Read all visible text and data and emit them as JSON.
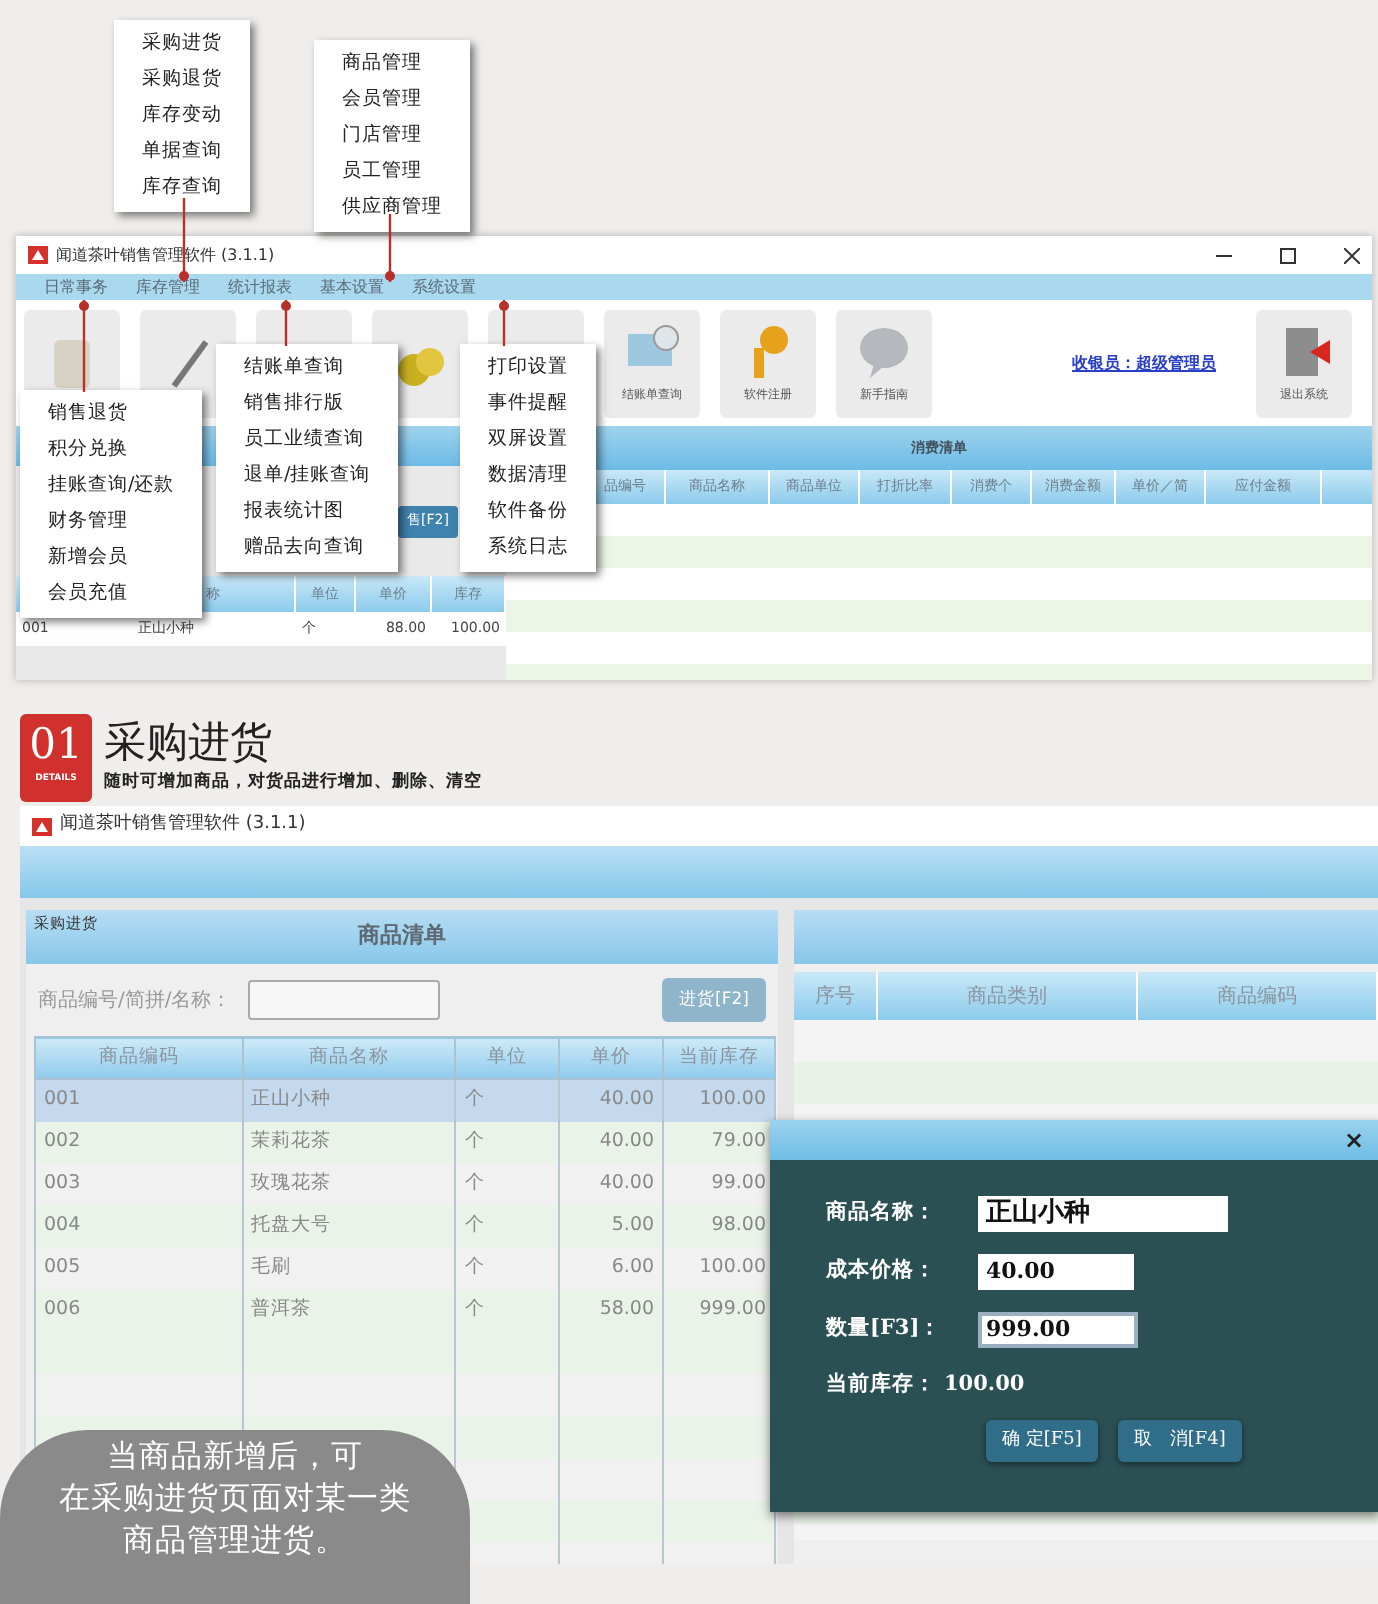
{
  "popup_menus": [
    {
      "items": [
        "采购进货",
        "采购退货",
        "库存变动",
        "单据查询",
        "库存查询"
      ]
    },
    {
      "items": [
        "商品管理",
        "会员管理",
        "门店管理",
        "员工管理",
        "供应商管理"
      ]
    },
    {
      "items": [
        "销售退货",
        "积分兑换",
        "挂账查询/还款",
        "财务管理",
        "新增会员",
        "会员充值"
      ]
    },
    {
      "items": [
        "结账单查询",
        "销售排行版",
        "员工业绩查询",
        "退单/挂账查询",
        "报表统计图",
        "赠品去向查询"
      ]
    },
    {
      "items": [
        "打印设置",
        "事件提醒",
        "双屏设置",
        "数据清理",
        "软件备份",
        "系统日志"
      ]
    }
  ],
  "main_window": {
    "title": "闻道茶叶销售管理软件 (3.1.1)",
    "menu": [
      "日常事务",
      "库存管理",
      "统计报表",
      "基本设置",
      "系统设置"
    ],
    "toolbar_labels": [
      "结账单查询",
      "软件注册",
      "新手指南"
    ],
    "cashier_link": "收银员：超级管理员",
    "exit_label": "退出系统",
    "sale_button": "售[F2]",
    "left_table": {
      "columns": [
        "",
        "称",
        "单位",
        "单价",
        "库存"
      ],
      "rows": [
        [
          "001",
          "正山小种",
          "个",
          "88.00",
          "100.00"
        ]
      ]
    },
    "bill": {
      "title": "消费清单",
      "columns": [
        "品编号",
        "商品名称",
        "商品单位",
        "打折比率",
        "消费个",
        "消费金额",
        "单价／简",
        "应付金额"
      ]
    }
  },
  "section": {
    "number": "01",
    "tag": "DETAILS",
    "title": "采购进货",
    "subtitle": "随时可增加商品，对货品进行增加、删除、清空"
  },
  "purchase_window": {
    "title": "闻道茶叶销售管理软件 (3.1.1)",
    "panel_label": "采购进货",
    "list_title": "商品清单",
    "search_label": "商品编号/简拼/名称：",
    "stock_button": "进货[F2]",
    "table": {
      "columns": [
        "商品编码",
        "商品名称",
        "单位",
        "单价",
        "当前库存"
      ],
      "rows": [
        {
          "cells": [
            "001",
            "正山小种",
            "个",
            "40.00",
            "100.00"
          ],
          "selected": true
        },
        {
          "cells": [
            "002",
            "茉莉花茶",
            "个",
            "40.00",
            "79.00"
          ],
          "selected": false
        },
        {
          "cells": [
            "003",
            "玫瑰花茶",
            "个",
            "40.00",
            "99.00"
          ],
          "selected": false
        },
        {
          "cells": [
            "004",
            "托盘大号",
            "个",
            "5.00",
            "98.00"
          ],
          "selected": false
        },
        {
          "cells": [
            "005",
            "毛刷",
            "个",
            "6.00",
            "100.00"
          ],
          "selected": false
        },
        {
          "cells": [
            "006",
            "普洱茶",
            "个",
            "58.00",
            "999.00"
          ],
          "selected": false
        }
      ]
    },
    "right_columns": [
      "序号",
      "商品类别",
      "商品编码"
    ],
    "dialog": {
      "close": "×",
      "fields": [
        {
          "label": "商品名称：",
          "value": "正山小种",
          "focused": false
        },
        {
          "label": "成本价格：",
          "value": "40.00",
          "focused": false
        },
        {
          "label": "数量[F3]：",
          "value": "999.00",
          "focused": true
        }
      ],
      "stock_label": "当前库存：",
      "stock_value": "100.00",
      "buttons": [
        "确 定[F5]",
        "取　消[F4]"
      ]
    }
  },
  "callout_lines": [
    "当商品新增后，可",
    "在采购进货页面对某一类",
    "商品管理进货。"
  ]
}
